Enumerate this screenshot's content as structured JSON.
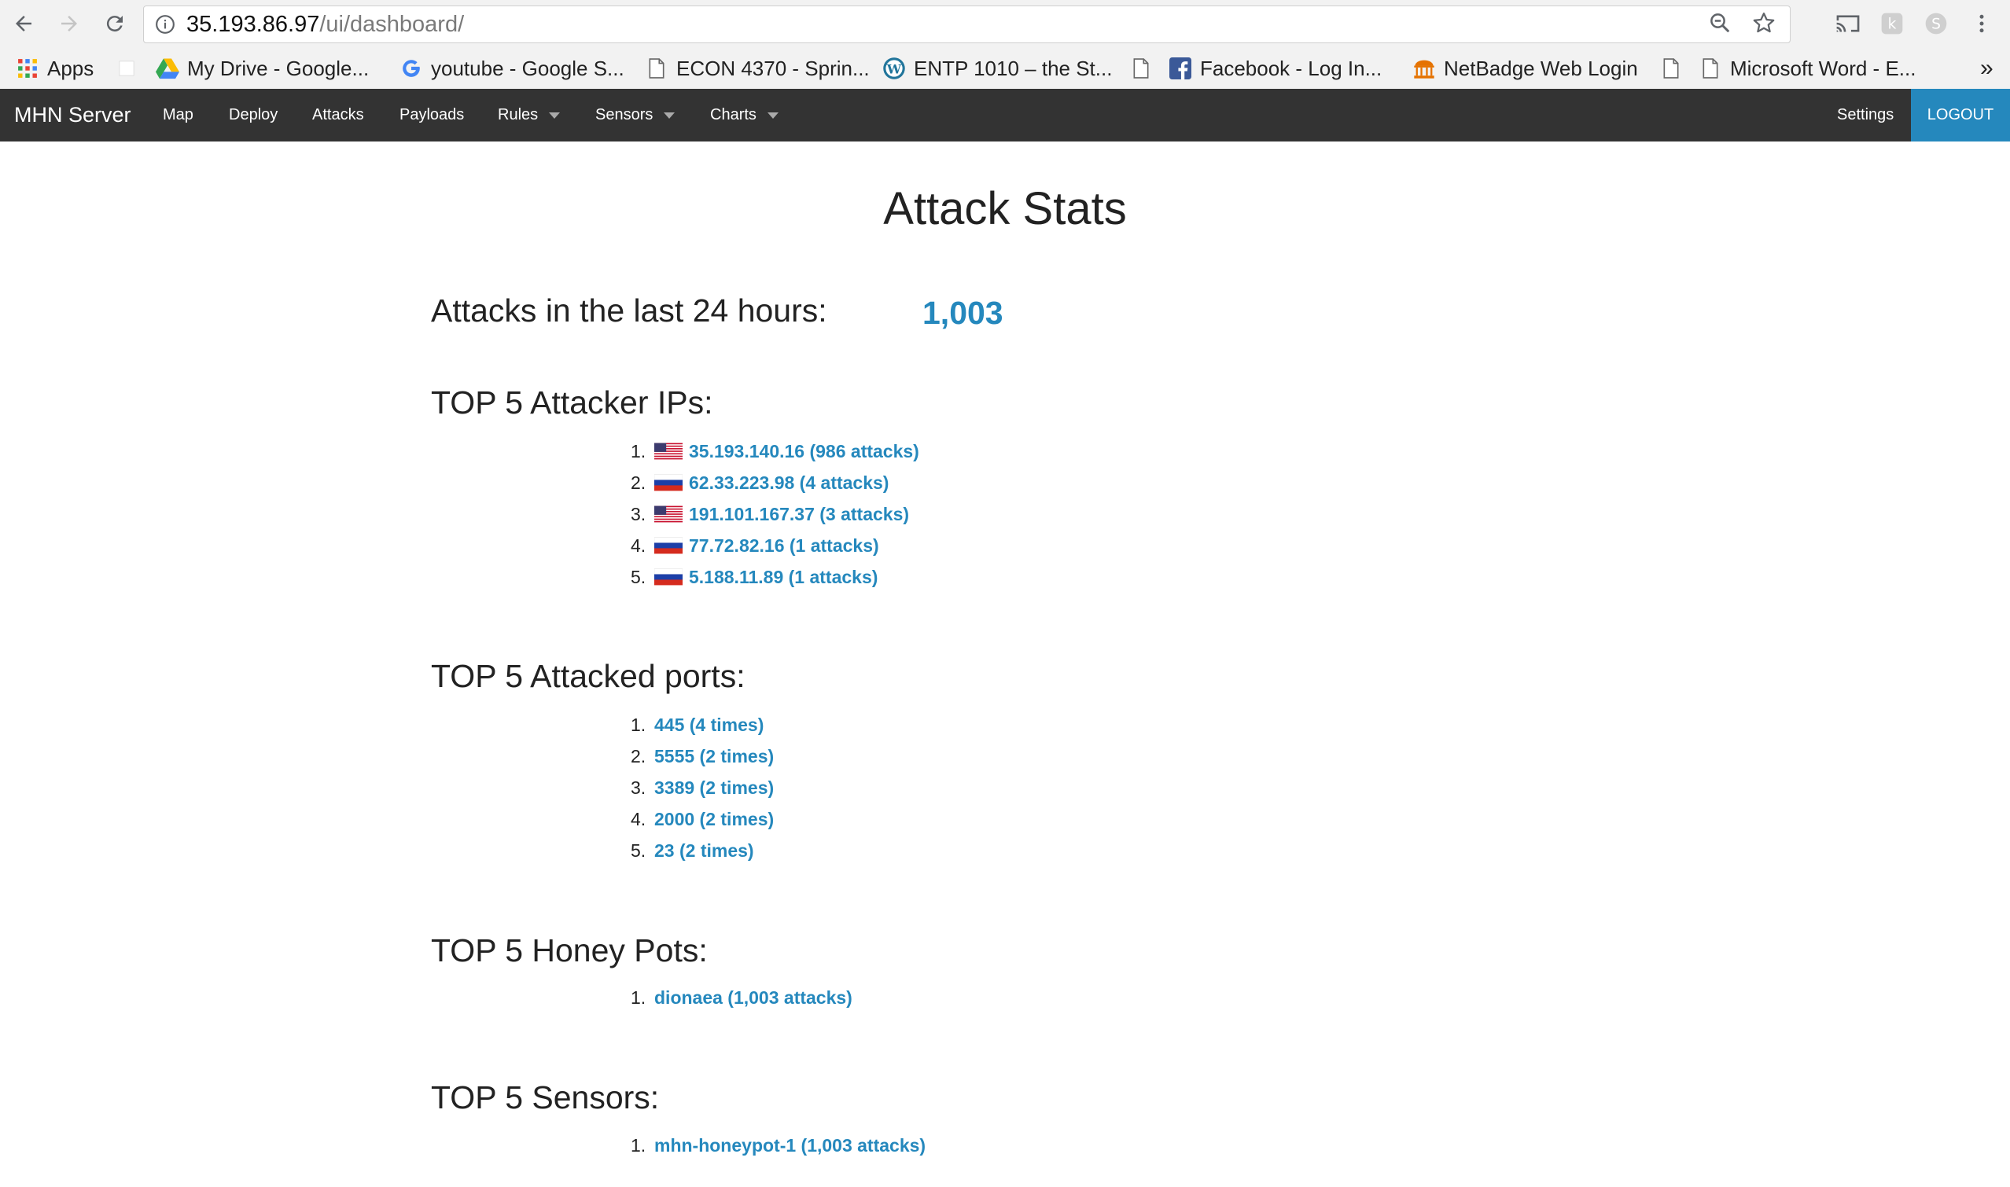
{
  "browser": {
    "url_host": "35.193.86.97",
    "url_path": "/ui/dashboard/",
    "bookmarks": [
      {
        "label": "Apps",
        "icon": "apps-grid-icon"
      },
      {
        "label": "My Drive - Google...",
        "icon": "google-drive-icon"
      },
      {
        "label": "youtube - Google S...",
        "icon": "google-icon"
      },
      {
        "label": "ECON 4370 - Sprin...",
        "icon": "page-icon"
      },
      {
        "label": "ENTP 1010 – the St...",
        "icon": "wordpress-icon"
      },
      {
        "label": "Facebook - Log In...",
        "icon": "facebook-icon"
      },
      {
        "label": "NetBadge Web Login",
        "icon": "rotunda-icon"
      },
      {
        "label": "Microsoft Word - E...",
        "icon": "page-icon"
      }
    ],
    "overflow_label": "»"
  },
  "navbar": {
    "brand": "MHN Server",
    "links": [
      "Map",
      "Deploy",
      "Attacks",
      "Payloads",
      "Rules",
      "Sensors",
      "Charts"
    ],
    "settings": "Settings",
    "logout": "LOGOUT",
    "accent_color": "#2588bd"
  },
  "main": {
    "title": "Attack Stats",
    "attacks_24h_label": "Attacks in the last 24 hours:",
    "attacks_24h_value": "1,003",
    "top_ips_heading": "TOP 5 Attacker IPs:",
    "top_ips": [
      {
        "num": "1.",
        "label": "35.193.140.16 (986 attacks)",
        "flag": "us-flag-icon"
      },
      {
        "num": "2.",
        "label": "62.33.223.98 (4 attacks)",
        "flag": "ru-flag-icon"
      },
      {
        "num": "3.",
        "label": "191.101.167.37 (3 attacks)",
        "flag": "us-flag-icon"
      },
      {
        "num": "4.",
        "label": "77.72.82.16 (1 attacks)",
        "flag": "ru-flag-icon"
      },
      {
        "num": "5.",
        "label": "5.188.11.89 (1 attacks)",
        "flag": "ru-flag-icon"
      }
    ],
    "top_ports_heading": "TOP 5 Attacked ports:",
    "top_ports": [
      {
        "num": "1.",
        "label": "445 (4 times)"
      },
      {
        "num": "2.",
        "label": "5555 (2 times)"
      },
      {
        "num": "3.",
        "label": "3389 (2 times)"
      },
      {
        "num": "4.",
        "label": "2000 (2 times)"
      },
      {
        "num": "5.",
        "label": "23 (2 times)"
      }
    ],
    "top_honeypots_heading": "TOP 5 Honey Pots:",
    "top_honeypots": [
      {
        "num": "1.",
        "label": "dionaea (1,003 attacks)"
      }
    ],
    "top_sensors_heading": "TOP 5 Sensors:",
    "top_sensors": [
      {
        "num": "1.",
        "label": "mhn-honeypot-1 (1,003 attacks)"
      }
    ]
  }
}
